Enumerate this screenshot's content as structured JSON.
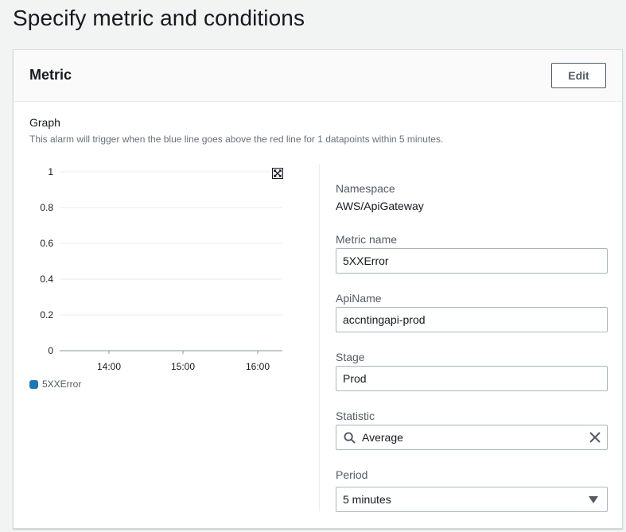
{
  "page_title": "Specify metric and conditions",
  "metric_card": {
    "title": "Metric",
    "edit_label": "Edit"
  },
  "graph": {
    "label": "Graph",
    "description": "This alarm will trigger when the blue line goes above the red line for 1 datapoints within 5 minutes.",
    "expand_icon": "expand-arrows-icon"
  },
  "chart_data": {
    "type": "line",
    "title": "",
    "xlabel": "",
    "ylabel": "",
    "ylim": [
      0,
      1
    ],
    "y_ticks": [
      "0",
      "0.2",
      "0.4",
      "0.6",
      "0.8",
      "1"
    ],
    "x_ticks": [
      "14:00",
      "15:00",
      "16:00"
    ],
    "grid": true,
    "legend_position": "bottom-left",
    "series": [
      {
        "name": "5XXError",
        "color": "#1f77b4",
        "values": []
      }
    ]
  },
  "fields": {
    "namespace": {
      "label": "Namespace",
      "value": "AWS/ApiGateway"
    },
    "metric_name": {
      "label": "Metric name",
      "value": "5XXError"
    },
    "api_name": {
      "label": "ApiName",
      "value": "accntingapi-prod"
    },
    "stage": {
      "label": "Stage",
      "value": "Prod"
    },
    "statistic": {
      "label": "Statistic",
      "value": "Average",
      "icon": "search-icon",
      "clear_icon": "close-icon"
    },
    "period": {
      "label": "Period",
      "value": "5 minutes",
      "icon": "caret-down-icon"
    }
  },
  "colors": {
    "series_blue": "#1f77b4",
    "border": "#aab7b8",
    "background": "#f2f3f3"
  }
}
